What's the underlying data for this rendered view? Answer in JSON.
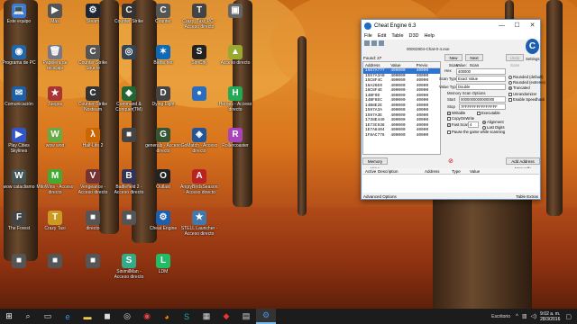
{
  "desktop": {
    "icons": [
      {
        "id": "este-equipo",
        "label": "Este equipo",
        "glyph": "💻",
        "color": "#3a7bd5"
      },
      {
        "id": "mas-del-juego",
        "label": "Más",
        "glyph": "▶",
        "color": "#555"
      },
      {
        "id": "steam",
        "label": "Steam",
        "glyph": "⚙",
        "color": "#1b2838"
      },
      {
        "id": "counter-strike-1",
        "label": "Counter Strike",
        "glyph": "C",
        "color": "#333"
      },
      {
        "id": "counter-strike-2",
        "label": "Counter",
        "glyph": "C",
        "color": "#555"
      },
      {
        "id": "crazy-taxi-pc",
        "label": "Crazy_Taxi_PC - Acceso directo",
        "glyph": "T",
        "color": "#444"
      },
      {
        "id": "nuevo-1",
        "label": "",
        "glyph": "▣",
        "color": "#666"
      },
      {
        "id": "programa-de-pc",
        "label": "Programa de PC",
        "glyph": "◉",
        "color": "#2266aa"
      },
      {
        "id": "papelera",
        "label": "Papelera de reciclaje",
        "glyph": "🗑",
        "color": "#778"
      },
      {
        "id": "counter-strike-source",
        "label": "Counter Strike Source",
        "glyph": "C",
        "color": "#555"
      },
      {
        "id": "steam-2",
        "label": "",
        "glyph": "◎",
        "color": "#345"
      },
      {
        "id": "battlenet",
        "label": "Battle.net",
        "glyph": "✶",
        "color": "#0e6ab8"
      },
      {
        "id": "simcity",
        "label": "SimCity",
        "glyph": "S",
        "color": "#222"
      },
      {
        "id": "acceso-directo-1",
        "label": "Acceso directo",
        "glyph": "▲",
        "color": "#9a3"
      },
      {
        "id": "comunicacion",
        "label": "Comunicación",
        "glyph": "✉",
        "color": "#1d5fa8"
      },
      {
        "id": "juegos",
        "label": "Juegos",
        "glyph": "★",
        "color": "#a33"
      },
      {
        "id": "counter-strike-nosteam",
        "label": "Counter-Strike Nosteam",
        "glyph": "C",
        "color": "#333"
      },
      {
        "id": "command-conquer",
        "label": "Command & Conquer(TM)",
        "glyph": "◆",
        "color": "#263"
      },
      {
        "id": "dying-light",
        "label": "Dying Light",
        "glyph": "D",
        "color": "#444"
      },
      {
        "id": "planet",
        "label": "",
        "glyph": "●",
        "color": "#2a6cc0"
      },
      {
        "id": "play-cities-skylines",
        "label": "Play Cities Skylines",
        "glyph": "▶",
        "color": "#35c"
      },
      {
        "id": "wow-wod",
        "label": "wow wod",
        "glyph": "W",
        "color": "#6a4"
      },
      {
        "id": "half-life-2",
        "label": "Half-Life 2",
        "glyph": "λ",
        "color": "#c60"
      },
      {
        "id": "generic-a",
        "label": "",
        "glyph": "■",
        "color": "#444"
      },
      {
        "id": "generals",
        "label": "generals - Acceso directo",
        "glyph": "G",
        "color": "#353"
      },
      {
        "id": "gomatch",
        "label": "GoMatch - Acceso directo",
        "glyph": "◈",
        "color": "#259"
      },
      {
        "id": "wow-cataclismo",
        "label": "wow cataclismo",
        "glyph": "W",
        "color": "#455"
      },
      {
        "id": "metin-wars",
        "label": "MitoWins - Acceso directo",
        "glyph": "M",
        "color": "#4a3"
      },
      {
        "id": "vengeance",
        "label": "Vengeance - Acceso directo",
        "glyph": "V",
        "color": "#733"
      },
      {
        "id": "battlefield",
        "label": "Battlefield 2 - Acceso directo",
        "glyph": "B",
        "color": "#335"
      },
      {
        "id": "outlast",
        "label": "Outlast",
        "glyph": "O",
        "color": "#222"
      },
      {
        "id": "angry-birds",
        "label": "AngryBirdsSeasons - Acceso directo",
        "glyph": "A",
        "color": "#b22"
      },
      {
        "id": "heroes",
        "label": "Heroes - Acceso directo",
        "glyph": "H",
        "color": "#2a5"
      },
      {
        "id": "the-forest",
        "label": "The Forest",
        "glyph": "F",
        "color": "#444"
      },
      {
        "id": "crazy-taxi",
        "label": "Crazy Taxi",
        "glyph": "T",
        "color": "#c92"
      },
      {
        "id": "generic-b",
        "label": "directo",
        "glyph": "■",
        "color": "#555"
      },
      {
        "id": "generic-c",
        "label": "",
        "glyph": "■",
        "color": "#555"
      },
      {
        "id": "cheat-engine",
        "label": "Cheat Engine",
        "glyph": "⚙",
        "color": "#1b5fae"
      },
      {
        "id": "stella",
        "label": "STELL Launcher - Acceso directo",
        "glyph": "★",
        "color": "#47a"
      },
      {
        "id": "rollercoaster",
        "label": "Rollercoaster",
        "glyph": "R",
        "color": "#a4b"
      },
      {
        "id": "bonus-b",
        "label": "",
        "glyph": "■",
        "color": "#555"
      },
      {
        "id": "tb-1",
        "label": "",
        "glyph": "■",
        "color": "#555"
      },
      {
        "id": "tb-2",
        "label": "",
        "glyph": "■",
        "color": "#555"
      },
      {
        "id": "sinimil",
        "label": "SinimilMan - Acceso directo",
        "glyph": "S",
        "color": "#3a8"
      },
      {
        "id": "ldm",
        "label": "LDM",
        "glyph": "L",
        "color": "#2b6"
      }
    ]
  },
  "cheatengine": {
    "title": "Cheat Engine 6.3",
    "menu": [
      "File",
      "Edit",
      "Table",
      "D3D",
      "Help"
    ],
    "process": "00002804-Chat-0-4.exe",
    "found": "Found: 27",
    "columns": [
      "Address",
      "Value",
      "Previo"
    ],
    "rows": [
      [
        "1557A???",
        "400000",
        "40000"
      ],
      [
        "1557A3A0",
        "400000",
        "40000"
      ],
      [
        "15C8F4C",
        "400000",
        "40000"
      ],
      [
        "16A26E0",
        "400000",
        "40000"
      ],
      [
        "16C8F4E",
        "400000",
        "40000"
      ],
      [
        "14BF9D",
        "400000",
        "40000"
      ],
      [
        "14BF8EC",
        "400000",
        "40000"
      ],
      [
        "14B8E2E",
        "400000",
        "40000"
      ],
      [
        "1597A3A",
        "400000",
        "40000"
      ],
      [
        "1597A3E",
        "400000",
        "40000"
      ],
      [
        "1738E449",
        "400000",
        "40000"
      ],
      [
        "1E73C938",
        "400000",
        "40000"
      ],
      [
        "1E7A8404",
        "400000",
        "40000"
      ],
      [
        "1F8AC776",
        "400000",
        "40000"
      ]
    ],
    "buttons": {
      "new_scan": "New Scan",
      "next_scan": "Next Scan",
      "undo_scan": "Undo Scan",
      "memory_view": "Memory View",
      "add_address": "Add Address Manually"
    },
    "value_label": "Value:",
    "value_text": "400000",
    "hex_label": "Hex",
    "scan_type_label": "Scan Type",
    "scan_type": "Exact Value",
    "value_type_label": "Value Type",
    "value_type": "Double",
    "mem_scan_options": "Memory Scan Options",
    "start_label": "Start",
    "start_value": "0000000000000000",
    "stop_label": "Stop",
    "stop_value": "7FFFFFFFFFFFFFFF",
    "writable": "Writable",
    "executable": "Executable",
    "copy_on_write": "CopyOnWrite",
    "fast_scan": "Fast Scan",
    "fast_scan_value": "4",
    "alignment": "Alignment",
    "last_digits": "Last Digits",
    "pause": "Pause the game while scanning",
    "rounded_default": "Rounded (default)",
    "rounded_extreme": "Rounded (extreme)",
    "truncated": "Truncated",
    "unrandomizer": "Unrandomizer",
    "enable_speedhack": "Enable Speedhack",
    "settings": "Settings",
    "lower_columns": [
      "Active",
      "Description",
      "Address",
      "Type",
      "Value"
    ],
    "advanced_options": "Advanced Options",
    "table_extras": "Table Extras"
  },
  "taskbar": {
    "language": "Escritorio",
    "time": "9:02 a. m.",
    "date": "28/3/2016"
  }
}
